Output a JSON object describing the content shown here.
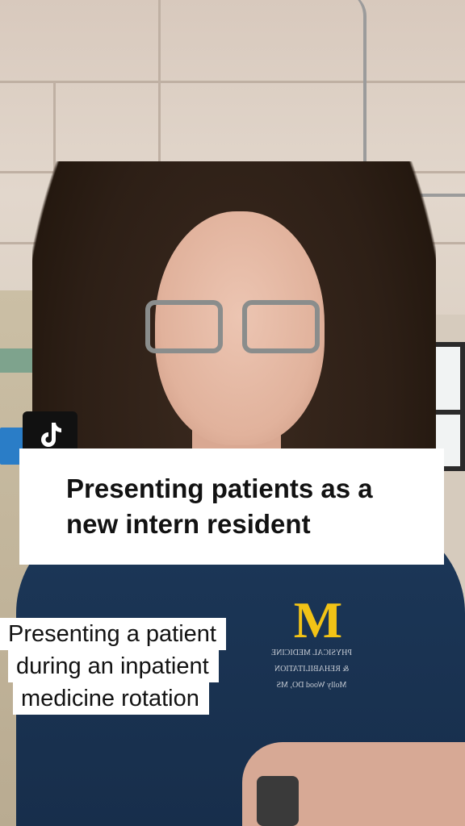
{
  "app": {
    "name": "TikTok",
    "logo_icon": "tiktok-logo-icon"
  },
  "title_overlay": {
    "lines": [
      "Presenting patients as a",
      "new intern resident"
    ]
  },
  "caption": {
    "lines": [
      "Presenting a patient",
      "during an inpatient",
      "medicine rotation"
    ]
  },
  "sweater_embroidery": {
    "logo": "M",
    "lines": [
      "PHYSICAL MEDICINE",
      "& REHABILITATION",
      "Molly Wood DO, MS"
    ]
  },
  "colors": {
    "logo_yellow": "#f2c316",
    "sweater_navy": "#1c3758",
    "overlay_bg": "#ffffff",
    "text": "#121212"
  }
}
